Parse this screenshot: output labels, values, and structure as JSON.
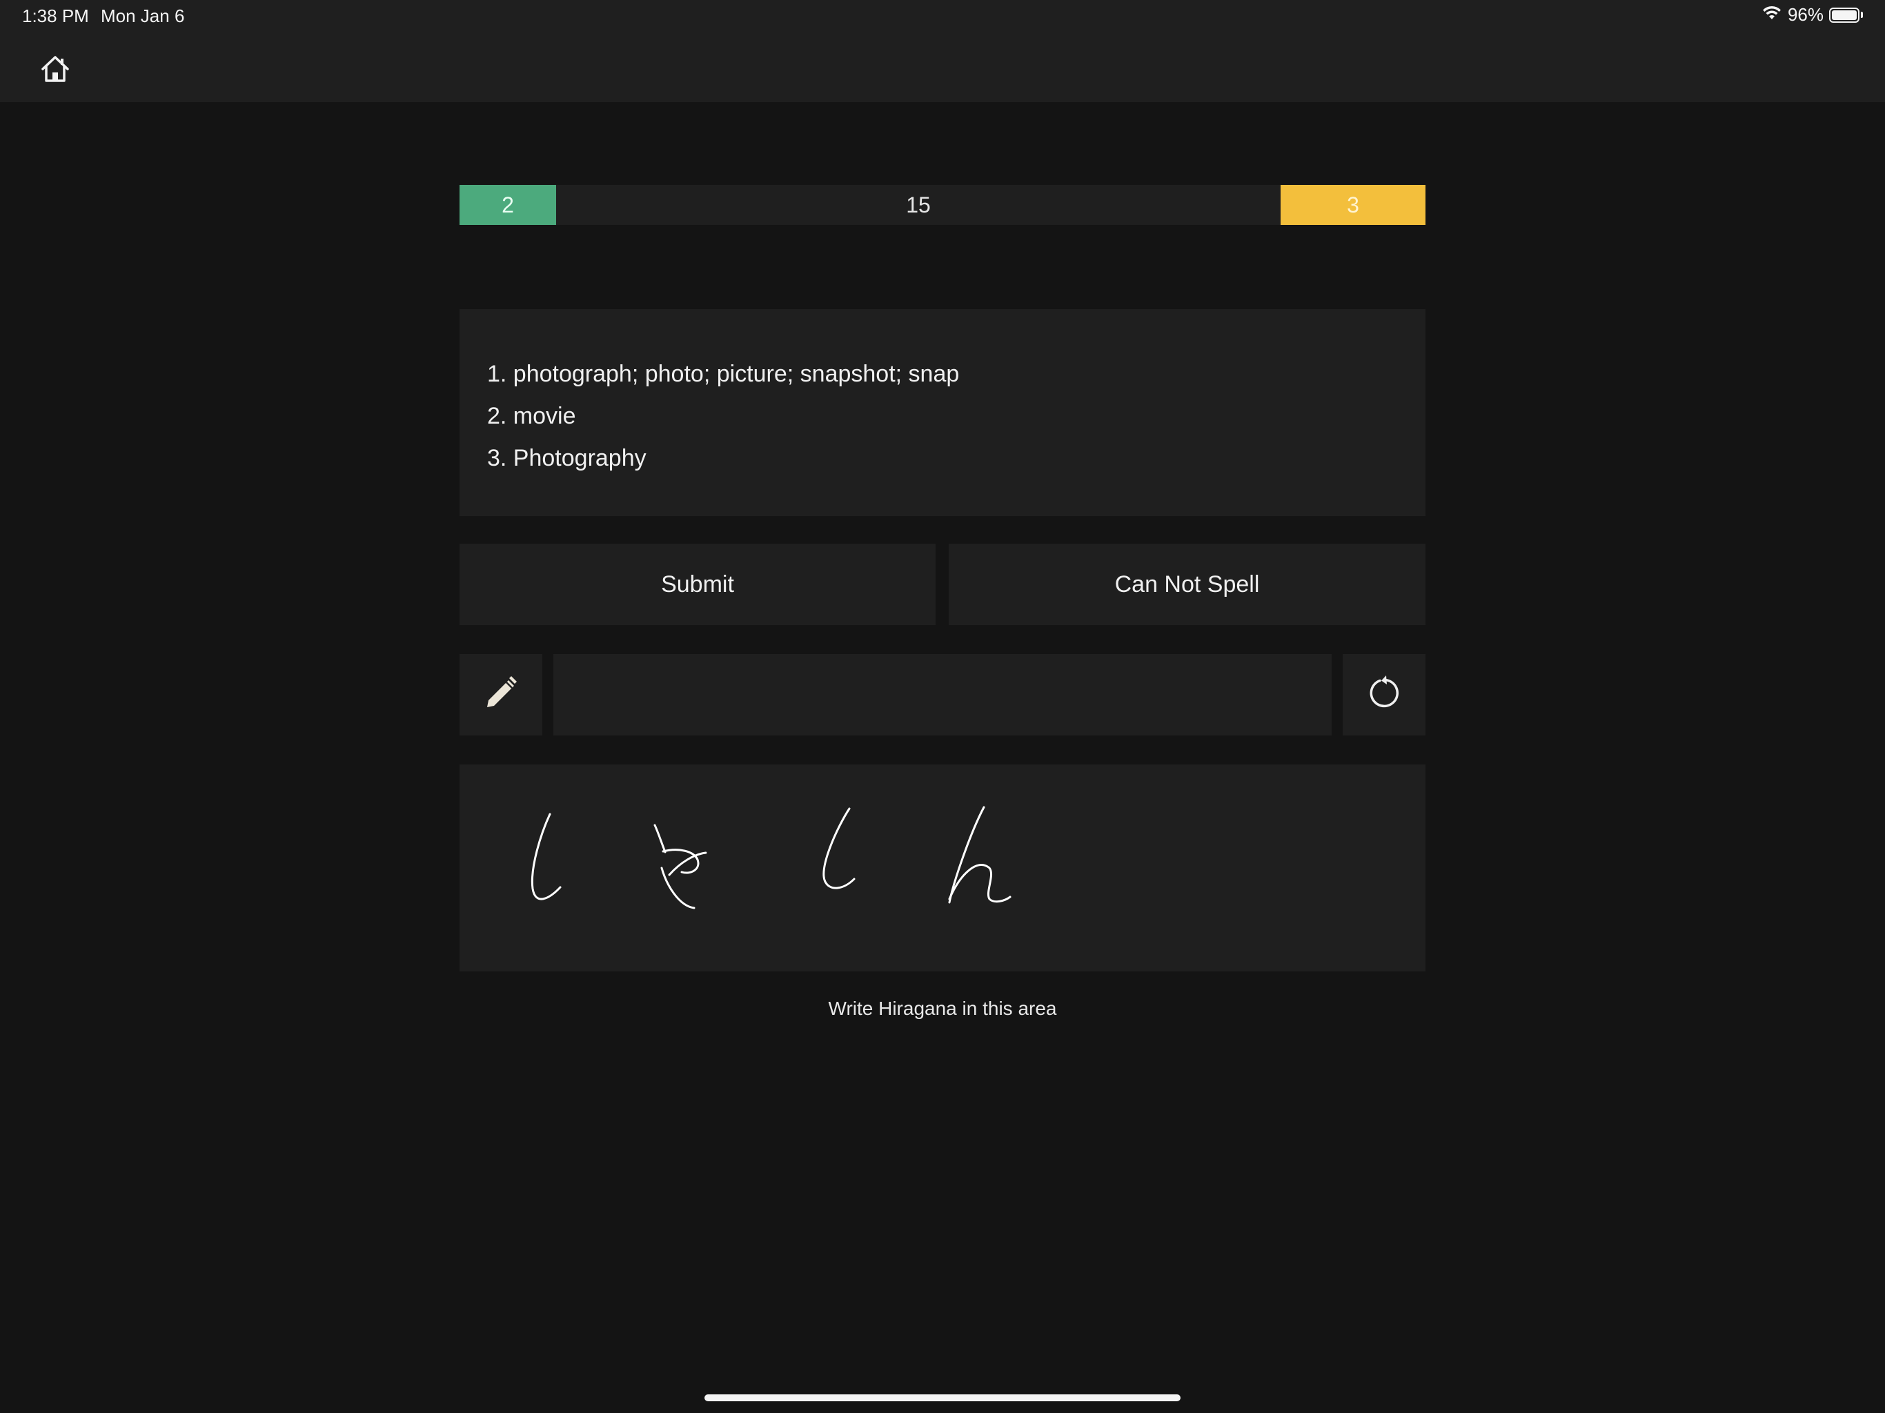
{
  "status_bar": {
    "time": "1:38 PM",
    "date": "Mon Jan 6",
    "battery_text": "96%",
    "battery_level": 0.96
  },
  "nav": {
    "home_icon": "home-icon"
  },
  "progress": {
    "correct": "2",
    "remaining": "15",
    "wrong": "3",
    "colors": {
      "correct": "#4caa7d",
      "wrong": "#f3bf3c"
    }
  },
  "definitions": [
    "1. photograph; photo; picture; snapshot; snap",
    "2. movie",
    "3. Photography"
  ],
  "actions": {
    "submit_label": "Submit",
    "cant_spell_label": "Can Not Spell"
  },
  "input_row": {
    "pencil_icon": "pencil-icon",
    "answer_value": "",
    "reset_icon": "refresh-icon"
  },
  "drawing": {
    "hint": "Write Hiragana in this area"
  }
}
